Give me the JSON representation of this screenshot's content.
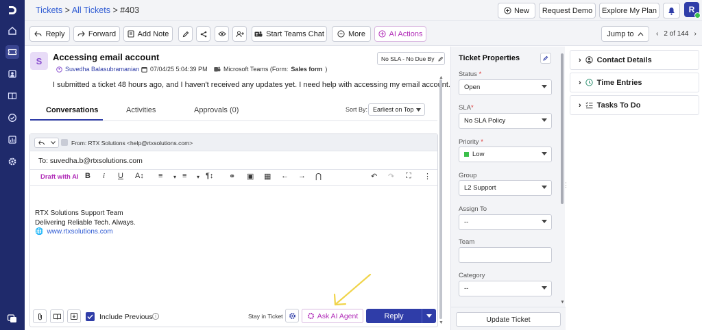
{
  "breadcrumb": {
    "tickets": "Tickets",
    "sep1": ">",
    "all": "All Tickets",
    "sep2": ">",
    "ticket_id": "#403"
  },
  "topbar": {
    "new": "New",
    "request_demo": "Request Demo",
    "explore": "Explore My Plan",
    "avatar": "R"
  },
  "toolbar": {
    "reply": "Reply",
    "forward": "Forward",
    "add_note": "Add Note",
    "teams_chat": "Start Teams Chat",
    "more": "More",
    "ai_actions": "AI Actions",
    "jump_to": "Jump to",
    "pager": "2 of 144"
  },
  "ticket": {
    "avatar": "S",
    "title": "Accessing email account",
    "sla": "No SLA - No Due By",
    "requester": "Suvedha Balasubramanian",
    "datetime": "07/04/25 5:04:39 PM",
    "source_prefix": "Microsoft Teams (Form: ",
    "source_form": "Sales form",
    "source_suffix": ")",
    "description": "I submitted a ticket 48 hours ago, and I haven't received any updates yet. I need help with accessing my email account."
  },
  "tabs": {
    "conversations": "Conversations",
    "activities": "Activities",
    "approvals": "Approvals (0)"
  },
  "sort": {
    "label": "Sort By:",
    "value": "Earliest on Top"
  },
  "editor": {
    "from": "From:  RTX Solutions <help@rtxsolutions.com>",
    "to": "To: suvedha.b@rtxsolutions.com",
    "draft_ai": "Draft with AI",
    "sig_line1": "RTX Solutions Support Team",
    "sig_line2": "Delivering Reliable Tech. Always.",
    "sig_link": "www.rtxsolutions.com",
    "include_previous": "Include Previous",
    "stay_in_ticket": "Stay in Ticket",
    "ask_ai": "Ask AI Agent",
    "reply": "Reply"
  },
  "props": {
    "title": "Ticket Properties",
    "status_label": "Status",
    "status": "Open",
    "sla_label": "SLA",
    "sla": "No SLA Policy",
    "priority_label": "Priority",
    "priority": "Low",
    "priority_color": "#3bbf4a",
    "group_label": "Group",
    "group": "L2 Support",
    "assign_label": "Assign To",
    "assign": "--",
    "team_label": "Team",
    "team": "",
    "category_label": "Category",
    "category": "--",
    "update": "Update Ticket"
  },
  "right_panel": {
    "contact": "Contact Details",
    "time": "Time Entries",
    "tasks": "Tasks To Do"
  },
  "colors": {
    "rail": "#1f2a6b",
    "primary": "#2f3da8",
    "ai": "#b12db8",
    "arrow": "#f0d44a"
  }
}
